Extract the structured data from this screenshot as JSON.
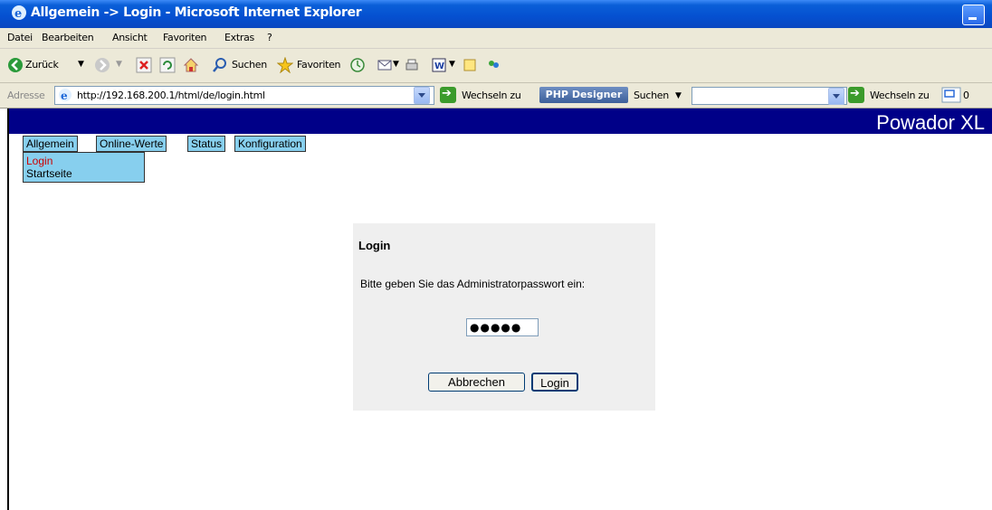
{
  "window": {
    "title": "Allgemein -> Login - Microsoft Internet Explorer"
  },
  "menu": {
    "items": [
      "Datei",
      "Bearbeiten",
      "Ansicht",
      "Favoriten",
      "Extras",
      "?"
    ]
  },
  "toolbar": {
    "back_label": "Zurück",
    "search_label": "Suchen",
    "favorites_label": "Favoriten"
  },
  "address": {
    "label": "Adresse",
    "url": "http://192.168.200.1/html/de/login.html",
    "go_label": "Wechseln zu",
    "php_designer_label": "PHP Designer",
    "search_label": "Suchen",
    "go2_label": "Wechseln zu",
    "counter": "0"
  },
  "page": {
    "brand": "Powador XL",
    "tabs": [
      "Allgemein",
      "Online-Werte",
      "Status",
      "Konfiguration"
    ],
    "submenu": {
      "active": "Login",
      "other": "Startseite"
    },
    "login": {
      "heading": "Login",
      "prompt": "Bitte geben Sie das Administratorpasswort ein:",
      "password_mask": "●●●●●",
      "cancel_label": "Abbrechen",
      "submit_label": "Login"
    }
  },
  "colors": {
    "banner": "#000088",
    "nav": "#87cfee",
    "active_link": "#cc0000"
  }
}
